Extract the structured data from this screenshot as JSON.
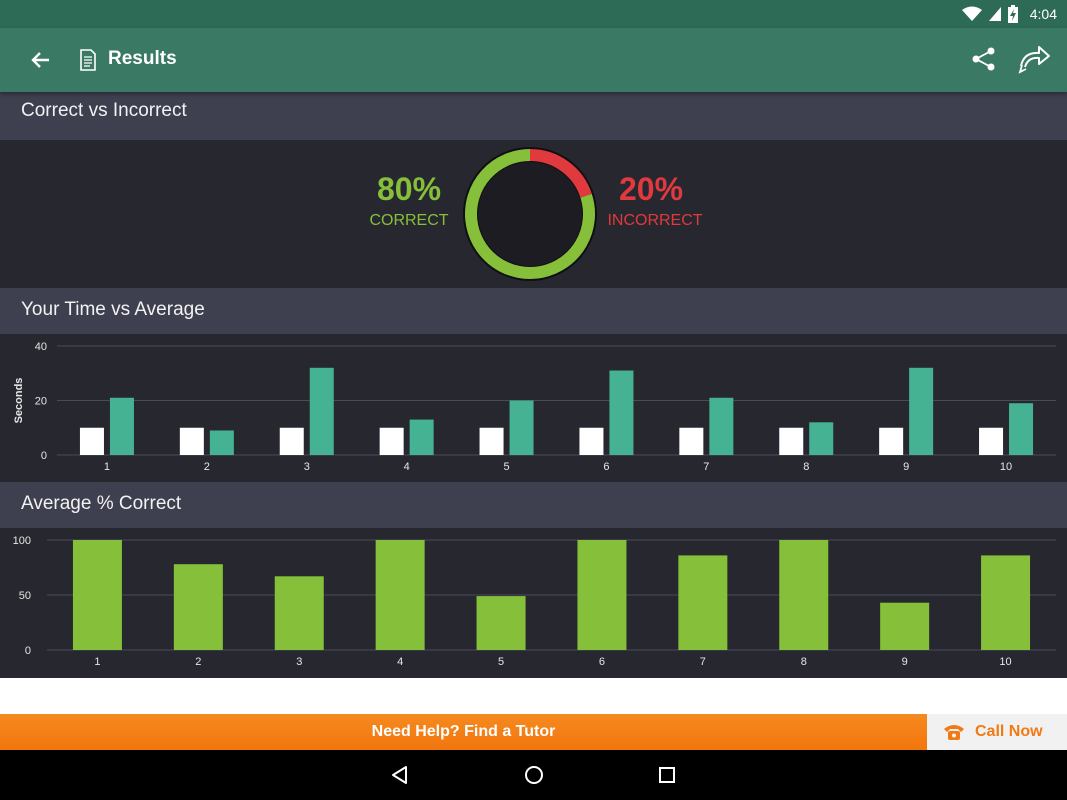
{
  "status_bar": {
    "time": "4:04"
  },
  "app_bar": {
    "title": "Results",
    "back_icon": "arrow-back-icon",
    "doc_icon": "document-icon",
    "share_icon": "share-icon",
    "redo_icon": "redo-arrow-icon"
  },
  "correct_section": {
    "header": "Correct vs Incorrect",
    "correct_pct": "80%",
    "correct_label": "CORRECT",
    "incorrect_pct": "20%",
    "incorrect_label": "INCORRECT",
    "colors": {
      "correct": "#86bf3a",
      "incorrect": "#e0393e"
    }
  },
  "time_section": {
    "header": "Your Time vs Average"
  },
  "avg_section": {
    "header": "Average % Correct"
  },
  "tutor": {
    "label": "Need Help? Find a Tutor",
    "call_label": "Call Now",
    "phone_icon": "phone-icon"
  },
  "nav": {
    "back": "nav-back-icon",
    "home": "nav-home-icon",
    "recents": "nav-recents-icon"
  },
  "chart_data": [
    {
      "type": "pie",
      "categories": [
        "Correct",
        "Incorrect"
      ],
      "values": [
        80,
        20
      ],
      "colors": [
        "#86bf3a",
        "#e0393e"
      ]
    },
    {
      "type": "bar",
      "categories": [
        "1",
        "2",
        "3",
        "4",
        "5",
        "6",
        "7",
        "8",
        "9",
        "10"
      ],
      "ylabel": "Seconds",
      "ylim": [
        0,
        40
      ],
      "yticks": [
        0,
        20,
        40
      ],
      "grid": true,
      "series": [
        {
          "values": [
            10,
            10,
            10,
            10,
            10,
            10,
            10,
            10,
            10,
            10
          ],
          "color": "#ffffff"
        },
        {
          "values": [
            21,
            9,
            32,
            13,
            20,
            31,
            21,
            12,
            32,
            19
          ],
          "color": "#45b393"
        }
      ]
    },
    {
      "type": "bar",
      "categories": [
        "1",
        "2",
        "3",
        "4",
        "5",
        "6",
        "7",
        "8",
        "9",
        "10"
      ],
      "ylim": [
        0,
        100
      ],
      "yticks": [
        0,
        50,
        100
      ],
      "grid": true,
      "series": [
        {
          "values": [
            100,
            78,
            67,
            100,
            49,
            100,
            86,
            100,
            43,
            86
          ],
          "color": "#86bf3a"
        }
      ]
    }
  ]
}
